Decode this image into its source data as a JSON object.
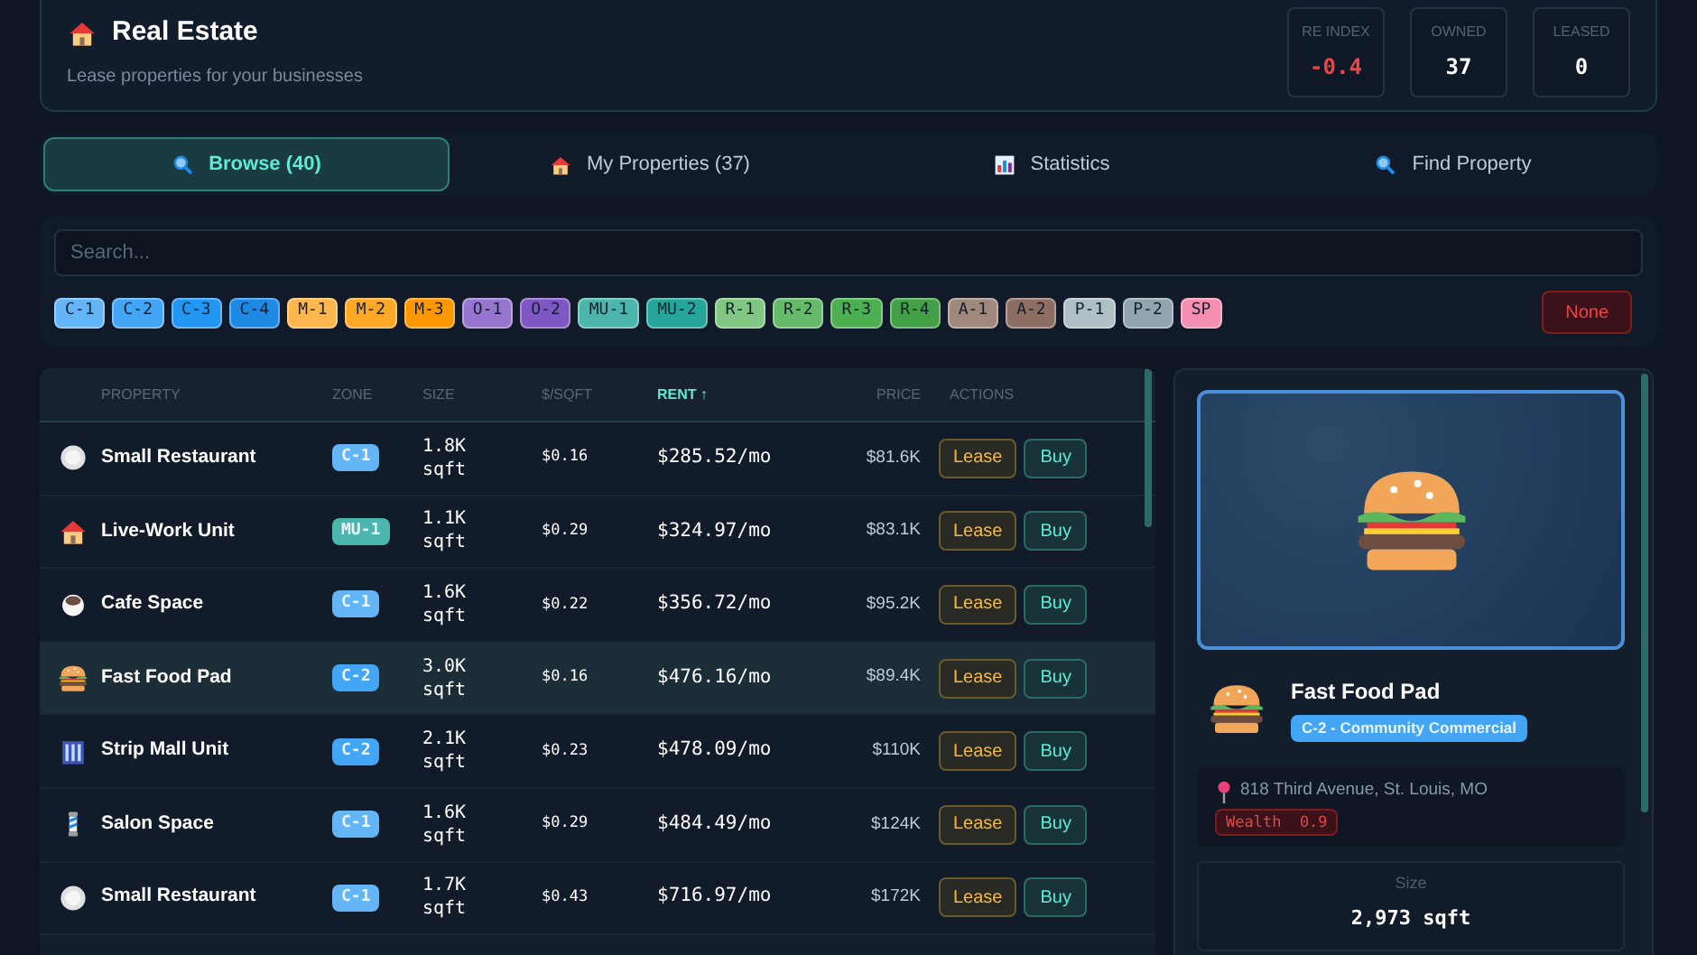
{
  "header": {
    "kind": "house",
    "title": "Real Estate",
    "subtitle": "Lease properties for your businesses",
    "stats": [
      {
        "label": "RE INDEX",
        "value": "-0.4",
        "color": "#ef4444"
      },
      {
        "label": "OWNED",
        "value": "37",
        "color": "#ffffff"
      },
      {
        "label": "LEASED",
        "value": "0",
        "color": "#ffffff"
      }
    ]
  },
  "tabs": [
    {
      "kind": "search",
      "label": "Browse (40)",
      "selected": true
    },
    {
      "kind": "house",
      "label": "My Properties (37)",
      "selected": false
    },
    {
      "kind": "chart",
      "label": "Statistics",
      "selected": false
    },
    {
      "kind": "search",
      "label": "Find Property",
      "selected": false
    }
  ],
  "filter": {
    "search": {
      "placeholder": "Search..."
    },
    "zones": [
      {
        "label": "C-1",
        "color": "#64b5f6"
      },
      {
        "label": "C-2",
        "color": "#42a5f5"
      },
      {
        "label": "C-3",
        "color": "#2196f3"
      },
      {
        "label": "C-4",
        "color": "#1e88e5"
      },
      {
        "label": "M-1",
        "color": "#ffb74d"
      },
      {
        "label": "M-2",
        "color": "#ffa726"
      },
      {
        "label": "M-3",
        "color": "#ff9800"
      },
      {
        "label": "O-1",
        "color": "#9575cd"
      },
      {
        "label": "O-2",
        "color": "#7e57c2"
      },
      {
        "label": "MU-1",
        "color": "#4db6ac"
      },
      {
        "label": "MU-2",
        "color": "#26a69a"
      },
      {
        "label": "R-1",
        "color": "#81c784"
      },
      {
        "label": "R-2",
        "color": "#66bb6a"
      },
      {
        "label": "R-3",
        "color": "#4caf50"
      },
      {
        "label": "R-4",
        "color": "#43a047"
      },
      {
        "label": "A-1",
        "color": "#a1887f"
      },
      {
        "label": "A-2",
        "color": "#8d6e63"
      },
      {
        "label": "P-1",
        "color": "#b0bec5"
      },
      {
        "label": "P-2",
        "color": "#90a4ae"
      },
      {
        "label": "SP",
        "color": "#f48fb1"
      }
    ],
    "none_button": "None"
  },
  "table": {
    "columns": [
      {
        "label": "PROPERTY",
        "active": false
      },
      {
        "label": "ZONE",
        "active": false
      },
      {
        "label": "SIZE",
        "active": false
      },
      {
        "label": "$/SQFT",
        "active": false
      },
      {
        "label": "RENT",
        "active": true,
        "sort_indicator": "↑"
      },
      {
        "label": "PRICE",
        "active": false
      },
      {
        "label": "ACTIONS",
        "active": false
      }
    ],
    "rows": [
      {
        "kind": "plate",
        "name": "Small Restaurant",
        "zone": "C-1",
        "color": "#64b5f6",
        "size": "1.8K sqft",
        "per_sqft": "$0.16",
        "rent": "$285.52/mo",
        "price": "$81.6K",
        "selected": false,
        "actions": [
          "Lease",
          "Buy"
        ]
      },
      {
        "kind": "house",
        "name": "Live-Work Unit",
        "zone": "MU-1",
        "color": "#4db6ac",
        "size": "1.1K sqft",
        "per_sqft": "$0.29",
        "rent": "$324.97/mo",
        "price": "$83.1K",
        "selected": false,
        "actions": [
          "Lease",
          "Buy"
        ]
      },
      {
        "kind": "coffee",
        "name": "Cafe Space",
        "zone": "C-1",
        "color": "#64b5f6",
        "size": "1.6K sqft",
        "per_sqft": "$0.22",
        "rent": "$356.72/mo",
        "price": "$95.2K",
        "selected": false,
        "actions": [
          "Lease",
          "Buy"
        ]
      },
      {
        "kind": "burger",
        "name": "Fast Food Pad",
        "zone": "C-2",
        "color": "#42a5f5",
        "size": "3.0K sqft",
        "per_sqft": "$0.16",
        "rent": "$476.16/mo",
        "price": "$89.4K",
        "selected": true,
        "actions": [
          "Lease",
          "Buy"
        ]
      },
      {
        "kind": "building",
        "name": "Strip Mall Unit",
        "zone": "C-2",
        "color": "#42a5f5",
        "size": "2.1K sqft",
        "per_sqft": "$0.23",
        "rent": "$478.09/mo",
        "price": "$110K",
        "selected": false,
        "actions": [
          "Lease",
          "Buy"
        ]
      },
      {
        "kind": "pole",
        "name": "Salon Space",
        "zone": "C-1",
        "color": "#64b5f6",
        "size": "1.6K sqft",
        "per_sqft": "$0.29",
        "rent": "$484.49/mo",
        "price": "$124K",
        "selected": false,
        "actions": [
          "Lease",
          "Buy"
        ]
      },
      {
        "kind": "plate",
        "name": "Small Restaurant",
        "zone": "C-1",
        "color": "#64b5f6",
        "size": "1.7K sqft",
        "per_sqft": "$0.43",
        "rent": "$716.97/mo",
        "price": "$172K",
        "selected": false,
        "actions": [
          "Lease",
          "Buy"
        ]
      }
    ]
  },
  "detail": {
    "kind": "burger",
    "name": "Fast Food Pad",
    "zone_badge": "C-2 - Community Commercial",
    "address": "818 Third Avenue, St. Louis, MO",
    "wealth_tag": "Wealth  0.9",
    "stats": [
      {
        "label": "Size",
        "value": "2,973 sqft"
      }
    ]
  }
}
